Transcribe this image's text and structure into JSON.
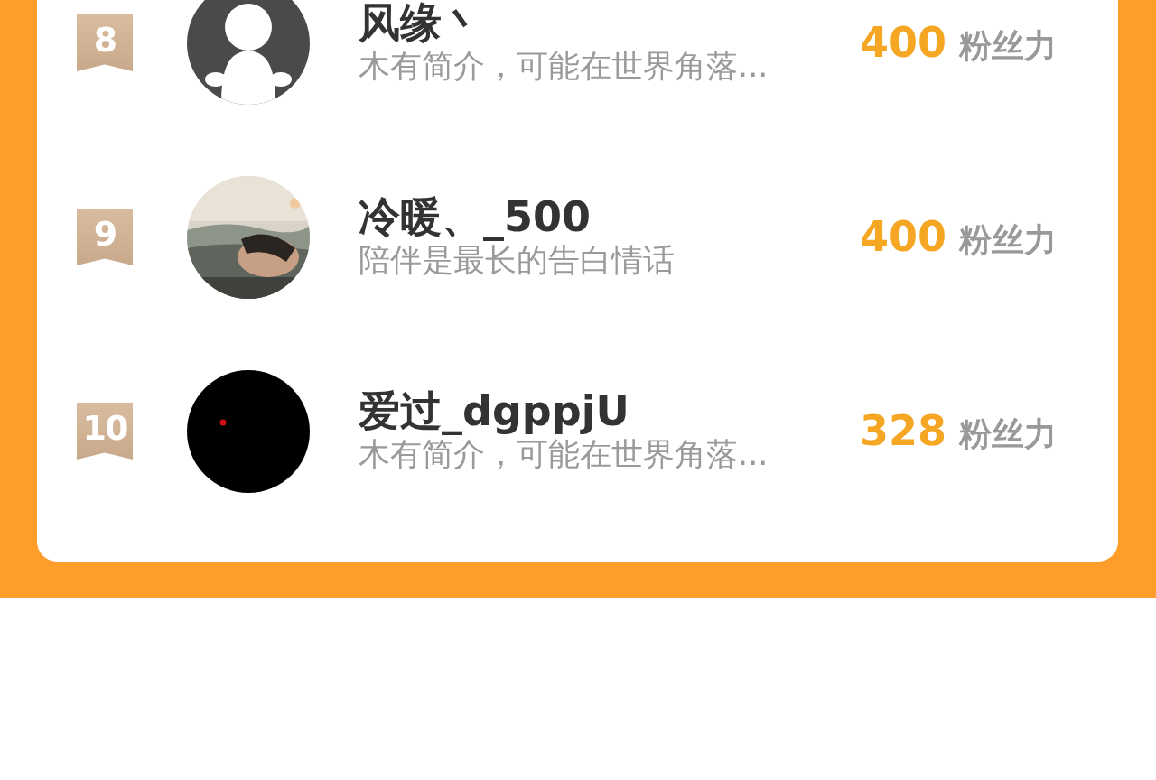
{
  "ranking": [
    {
      "rank": "8",
      "avatar": {
        "kind": "default"
      },
      "name": "风缘丶",
      "bio": "木有简介，可能在世界角落...",
      "score": "400",
      "score_label": "粉丝力"
    },
    {
      "rank": "9",
      "name": "冷暖、_500",
      "bio": "陪伴是最长的告白情话",
      "score": "400",
      "score_label": "粉丝力"
    },
    {
      "rank": "10",
      "name": "爱过_dgppjU",
      "bio": "木有简介，可能在世界角落...",
      "score": "328",
      "score_label": "粉丝力"
    }
  ]
}
